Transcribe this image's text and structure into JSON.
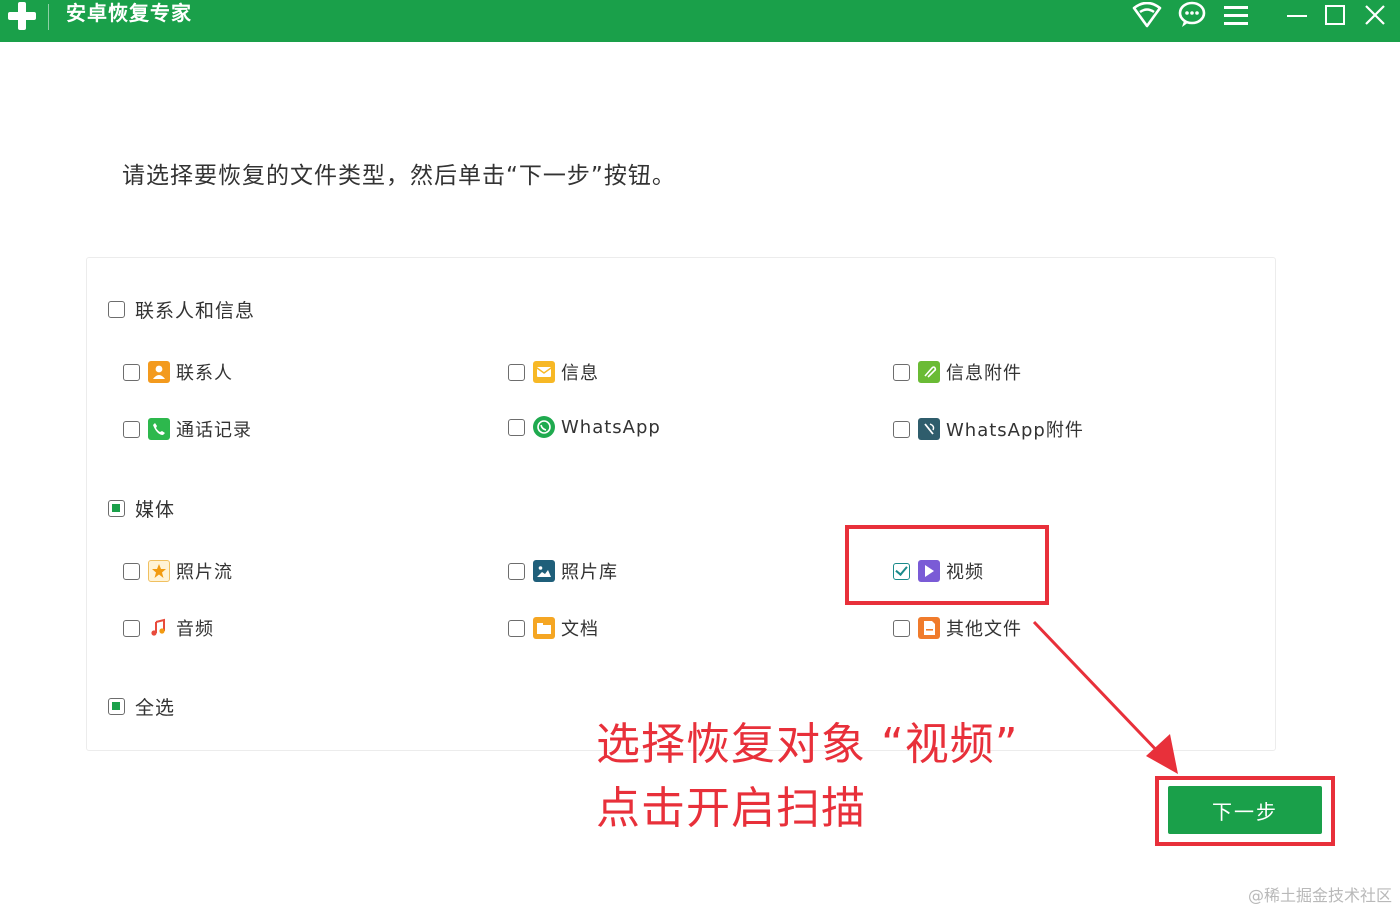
{
  "window": {
    "title": "安卓恢复专家",
    "icons": [
      "wifi-icon",
      "chat-icon",
      "menu-icon",
      "minimize-icon",
      "maximize-icon",
      "close-icon"
    ]
  },
  "instruction": "请选择要恢复的文件类型，然后单击“下一步”按钮。",
  "groups": {
    "contacts": {
      "label": "联系人和信息",
      "state": "unchecked",
      "items": [
        {
          "label": "联系人",
          "icon": "contact-icon",
          "checked": false
        },
        {
          "label": "信息",
          "icon": "message-icon",
          "checked": false
        },
        {
          "label": "信息附件",
          "icon": "attachment-icon",
          "checked": false
        },
        {
          "label": "通话记录",
          "icon": "phone-icon",
          "checked": false
        },
        {
          "label": "WhatsApp",
          "icon": "whatsapp-icon",
          "checked": false
        },
        {
          "label": "WhatsApp附件",
          "icon": "whatsapp-attachment-icon",
          "checked": false
        }
      ]
    },
    "media": {
      "label": "媒体",
      "state": "partial",
      "items": [
        {
          "label": "照片流",
          "icon": "star-icon",
          "checked": false
        },
        {
          "label": "照片库",
          "icon": "photo-icon",
          "checked": false
        },
        {
          "label": "视频",
          "icon": "video-icon",
          "checked": true
        },
        {
          "label": "音频",
          "icon": "music-icon",
          "checked": false
        },
        {
          "label": "文档",
          "icon": "folder-icon",
          "checked": false
        },
        {
          "label": "其他文件",
          "icon": "file-icon",
          "checked": false
        }
      ]
    }
  },
  "select_all": {
    "label": "全选",
    "state": "partial"
  },
  "annotation": {
    "line1": "选择恢复对象 “视频”",
    "line2": "点击开启扫描"
  },
  "next_button": "下一步",
  "watermark": "@稀土掘金技术社区",
  "colors": {
    "brand": "#1aa04a",
    "annotation": "#e8303a"
  }
}
